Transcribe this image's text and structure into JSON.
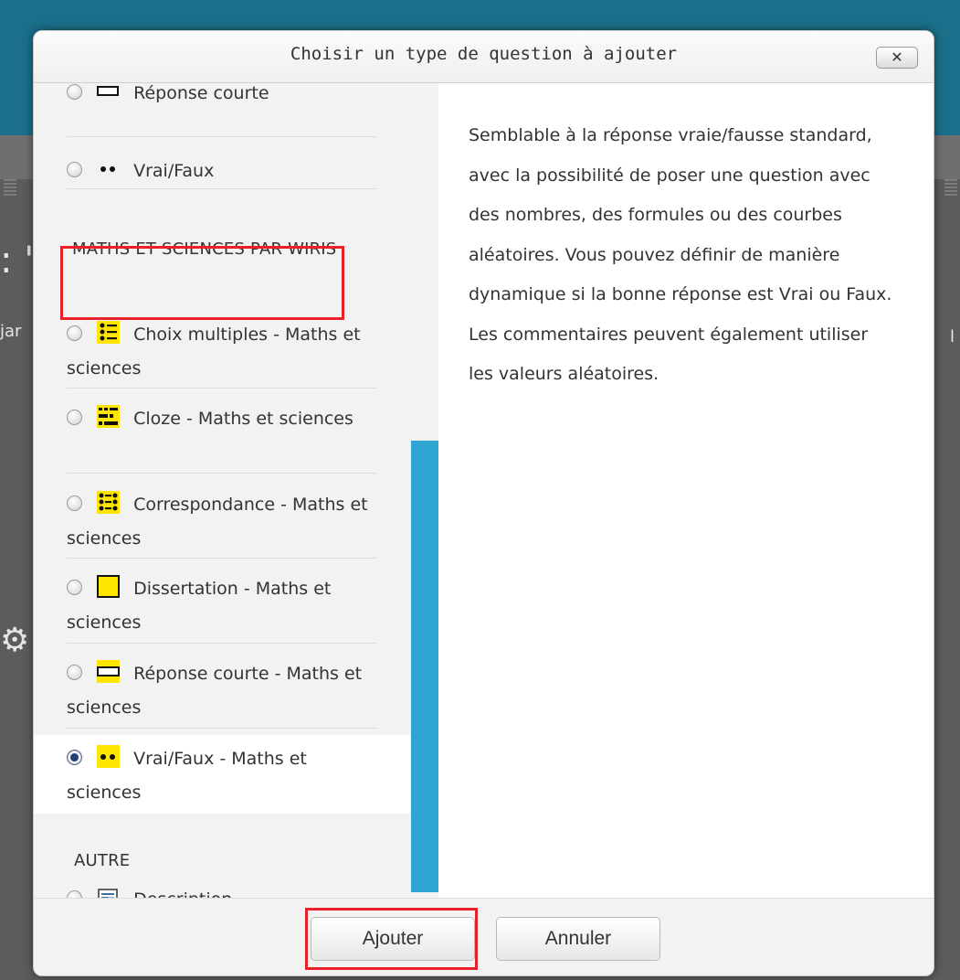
{
  "dialog": {
    "title": "Choisir un type de question à ajouter",
    "close_label": "✕"
  },
  "background_page": {
    "fragment_big": ": '",
    "fragment_small": "jar",
    "fragment_right": "l",
    "fragment_bottom": "..."
  },
  "options": {
    "top_items": [
      {
        "label": "Réponse courte",
        "icon": "short-answer-icon"
      },
      {
        "label": "Vrai/Faux",
        "icon": "true-false-icon"
      }
    ],
    "section_wiris": "MATHS ET SCIENCES PAR WIRIS",
    "wiris_items": [
      {
        "label": "Choix multiples - Maths et sciences",
        "icon": "multichoice-wiris-icon",
        "selected": false
      },
      {
        "label": "Cloze - Maths et sciences",
        "icon": "cloze-wiris-icon",
        "selected": false
      },
      {
        "label": "Correspondance - Maths et sciences",
        "icon": "matching-wiris-icon",
        "selected": false
      },
      {
        "label": "Dissertation - Maths et sciences",
        "icon": "essay-wiris-icon",
        "selected": false
      },
      {
        "label": "Réponse courte - Maths et sciences",
        "icon": "short-answer-wiris-icon",
        "selected": false
      },
      {
        "label": "Vrai/Faux - Maths et sciences",
        "icon": "true-false-wiris-icon",
        "selected": true
      }
    ],
    "section_other": "AUTRE",
    "other_items": [
      {
        "label": "Description",
        "icon": "description-icon"
      }
    ]
  },
  "description": "Semblable à la réponse vraie/fausse standard, avec la possibilité de poser une question avec des nombres, des formules ou des courbes aléatoires. Vous pouvez définir de manière dynamique si la bonne réponse est Vrai ou Faux. Les commentaires peuvent également utiliser les valeurs aléatoires.",
  "footer": {
    "add_label": "Ajouter",
    "cancel_label": "Annuler"
  },
  "colors": {
    "highlight": "#e8202a",
    "scrollbar": "#2fa6d1",
    "wiris_icon": "#ffe600"
  }
}
